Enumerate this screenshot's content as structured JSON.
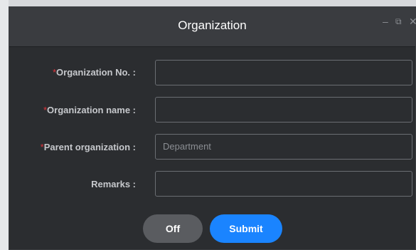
{
  "dialog": {
    "title": "Organization",
    "controls": {
      "minimize": "–",
      "restore": "⧉",
      "close": "✕"
    }
  },
  "form": {
    "fields": [
      {
        "required_mark": "*",
        "label": "Organization No. :",
        "value": "",
        "placeholder": ""
      },
      {
        "required_mark": "*",
        "label": "Organization name :",
        "value": "",
        "placeholder": ""
      },
      {
        "required_mark": "*",
        "label": "Parent organization :",
        "value": "Department",
        "placeholder": ""
      },
      {
        "required_mark": "",
        "label": "Remarks :",
        "value": "",
        "placeholder": ""
      }
    ]
  },
  "buttons": {
    "off": "Off",
    "submit": "Submit"
  },
  "colors": {
    "background": "#2b2d30",
    "title_bar": "#3a3c40",
    "required": "#e0333a",
    "primary": "#1a84ff",
    "secondary_button": "#5a5c60"
  }
}
